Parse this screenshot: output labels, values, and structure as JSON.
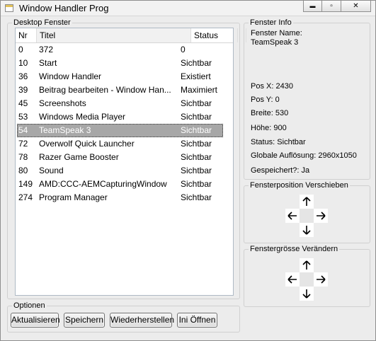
{
  "window": {
    "title": "Window Handler Prog",
    "controls": {
      "minimize": "▬",
      "maximize": "▫",
      "close": "✕"
    }
  },
  "desktop": {
    "group_label": "Desktop Fenster",
    "columns": {
      "nr": "Nr",
      "titel": "Titel",
      "status": "Status"
    },
    "rows": [
      {
        "nr": "0",
        "titel": "372",
        "status": "0"
      },
      {
        "nr": "10",
        "titel": "Start",
        "status": "Sichtbar"
      },
      {
        "nr": "36",
        "titel": "Window Handler",
        "status": "Existiert"
      },
      {
        "nr": "39",
        "titel": "Beitrag bearbeiten - Window Han...",
        "status": "Maximiert"
      },
      {
        "nr": "45",
        "titel": "Screenshots",
        "status": "Sichtbar"
      },
      {
        "nr": "53",
        "titel": "Windows Media Player",
        "status": "Sichtbar"
      },
      {
        "nr": "54",
        "titel": "TeamSpeak 3",
        "status": "Sichtbar",
        "selected": true
      },
      {
        "nr": "72",
        "titel": "Overwolf Quick Launcher",
        "status": "Sichtbar"
      },
      {
        "nr": "78",
        "titel": "Razer Game Booster",
        "status": "Sichtbar"
      },
      {
        "nr": "80",
        "titel": "Sound",
        "status": "Sichtbar"
      },
      {
        "nr": "149",
        "titel": "AMD:CCC-AEMCapturingWindow",
        "status": "Sichtbar"
      },
      {
        "nr": "274",
        "titel": "Program Manager",
        "status": "Sichtbar"
      }
    ]
  },
  "info": {
    "group_label": "Fenster Info",
    "name_label": "Fenster Name:",
    "name_value": "TeamSpeak 3",
    "pos_x": "Pos X: 2430",
    "pos_y": "Pos Y: 0",
    "breite": "Breite: 530",
    "hoehe": "Höhe: 900",
    "status": "Status: Sichtbar",
    "aufloesung": "Globale Auflösung: 2960x1050",
    "gespeichert": "Gespeichert?: Ja"
  },
  "move": {
    "group_label": "Fensterposition Verschieben"
  },
  "resize": {
    "group_label": "Fenstergrösse Verändern"
  },
  "options": {
    "group_label": "Optionen",
    "buttons": {
      "refresh": "Aktualisieren",
      "save": "Speichern",
      "restore": "Wiederherstellen",
      "open_ini": "Ini Öffnen"
    }
  },
  "colors": {
    "selection": "#a7a7a7",
    "window_bg": "#ececec"
  }
}
